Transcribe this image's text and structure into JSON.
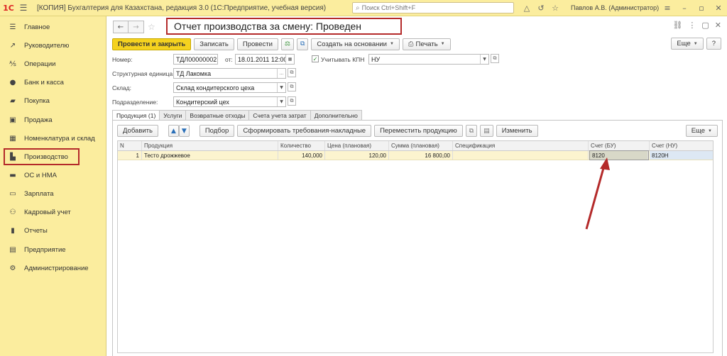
{
  "app": {
    "logo": "1С",
    "title": "[КОПИЯ] Бухгалтерия для Казахстана, редакция 3.0  (1С:Предприятие, учебная версия)",
    "search_placeholder": "Поиск Ctrl+Shift+F",
    "user": "Павлов А.В. (Администратор)"
  },
  "sidebar": {
    "items": [
      {
        "label": "Главное",
        "icon": "menu-icon"
      },
      {
        "label": "Руководителю",
        "icon": "chart-icon"
      },
      {
        "label": "Операции",
        "icon": "operations-icon"
      },
      {
        "label": "Банк и касса",
        "icon": "bank-icon"
      },
      {
        "label": "Покупка",
        "icon": "cart-icon"
      },
      {
        "label": "Продажа",
        "icon": "bag-icon"
      },
      {
        "label": "Номенклатура и склад",
        "icon": "grid-icon"
      },
      {
        "label": "Производство",
        "icon": "factory-icon"
      },
      {
        "label": "ОС и НМА",
        "icon": "truck-icon"
      },
      {
        "label": "Зарплата",
        "icon": "salary-icon"
      },
      {
        "label": "Кадровый учет",
        "icon": "people-icon"
      },
      {
        "label": "Отчеты",
        "icon": "reports-icon"
      },
      {
        "label": "Предприятие",
        "icon": "enterprise-icon"
      },
      {
        "label": "Администрирование",
        "icon": "gear-icon"
      }
    ],
    "active_index": 7
  },
  "document": {
    "title": "Отчет производства за смену: Проведен",
    "toolbar": {
      "post_close": "Провести и закрыть",
      "save": "Записать",
      "post": "Провести",
      "create_based": "Создать на основании",
      "print": "Печать",
      "more": "Еще",
      "help": "?"
    },
    "fields": {
      "number_label": "Номер:",
      "number": "ТДЛ00000002",
      "date_label": "от:",
      "date": "18.01.2011 12:00:00",
      "kpn_label": "Учитывать КПН",
      "kpn_value": "НУ",
      "unit_label": "Структурная единица:",
      "unit": "ТД Лакомка",
      "warehouse_label": "Склад:",
      "warehouse": "Склад кондитерского цеха",
      "division_label": "Подразделение:",
      "division": "Кондитерский цех"
    },
    "tabs": [
      "Продукция (1)",
      "Услуги",
      "Возвратные отходы",
      "Счета учета затрат",
      "Дополнительно"
    ],
    "panel_toolbar": {
      "add": "Добавить",
      "selection": "Подбор",
      "form_requests": "Сформировать требования-накладные",
      "move_products": "Переместить продукцию",
      "change": "Изменить",
      "more": "Еще"
    },
    "table": {
      "columns": [
        "N",
        "Продукция",
        "Количество",
        "Цена (плановая)",
        "Сумма (плановая)",
        "Спецификация",
        "Счет (БУ)",
        "Счет (НУ)"
      ],
      "rows": [
        {
          "n": "1",
          "product": "Тесто дрожжевое",
          "qty": "140,000",
          "price": "120,00",
          "sum": "16 800,00",
          "spec": "",
          "account_bu": "8120",
          "account_nu": "8120Н"
        }
      ]
    }
  }
}
